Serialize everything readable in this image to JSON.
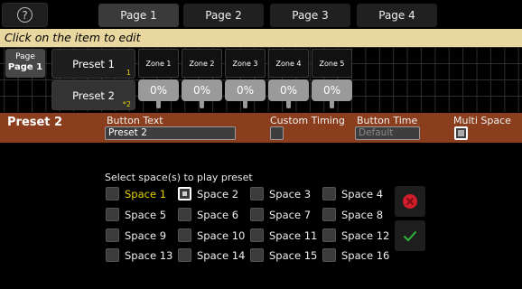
{
  "help": {
    "icon": "question-circle-icon",
    "glyph": "?"
  },
  "tabs": [
    {
      "label": "Page 1",
      "active": true
    },
    {
      "label": "Page 2",
      "active": false
    },
    {
      "label": "Page 3",
      "active": false
    },
    {
      "label": "Page 4",
      "active": false
    }
  ],
  "instruction": "Click on the item to edit",
  "page_button": {
    "line1": "Page",
    "line2": "Page 1"
  },
  "presets": [
    {
      "label": "Preset 1",
      "badge": "1",
      "selected": false
    },
    {
      "label": "Preset 2",
      "badge": "*2",
      "selected": true
    }
  ],
  "zones": [
    {
      "label": "Zone 1",
      "value": "0%"
    },
    {
      "label": "Zone 2",
      "value": "0%"
    },
    {
      "label": "Zone 3",
      "value": "0%"
    },
    {
      "label": "Zone 4",
      "value": "0%"
    },
    {
      "label": "Zone 5",
      "value": "0%"
    }
  ],
  "settings": {
    "title": "Preset 2",
    "button_text_label": "Button Text",
    "button_text_value": "Preset 2",
    "custom_timing_label": "Custom Timing",
    "custom_timing_checked": false,
    "button_time_label": "Button Time",
    "button_time_placeholder": "Default",
    "multi_space_label": "Multi Space",
    "multi_space_checked": true
  },
  "spaces_heading": "Select space(s) to play preset",
  "spaces": [
    {
      "label": "Space 1",
      "checked": false,
      "highlight": true
    },
    {
      "label": "Space 2",
      "checked": true,
      "highlight": false
    },
    {
      "label": "Space 3",
      "checked": false,
      "highlight": false
    },
    {
      "label": "Space 4",
      "checked": false,
      "highlight": false
    },
    {
      "label": "Space 5",
      "checked": false,
      "highlight": false
    },
    {
      "label": "Space 6",
      "checked": false,
      "highlight": false
    },
    {
      "label": "Space 7",
      "checked": false,
      "highlight": false
    },
    {
      "label": "Space 8",
      "checked": false,
      "highlight": false
    },
    {
      "label": "Space 9",
      "checked": false,
      "highlight": false
    },
    {
      "label": "Space 10",
      "checked": false,
      "highlight": false
    },
    {
      "label": "Space 11",
      "checked": false,
      "highlight": false
    },
    {
      "label": "Space 12",
      "checked": false,
      "highlight": false
    },
    {
      "label": "Space 13",
      "checked": false,
      "highlight": false
    },
    {
      "label": "Space 14",
      "checked": false,
      "highlight": false
    },
    {
      "label": "Space 15",
      "checked": false,
      "highlight": false
    },
    {
      "label": "Space 16",
      "checked": false,
      "highlight": false
    }
  ],
  "actions": {
    "cancel_icon": "cancel-icon",
    "confirm_icon": "checkmark-icon"
  },
  "colors": {
    "settings_bar": "#8a3e1d",
    "instruction_bar": "#e8d79f",
    "highlight": "#e6d200",
    "cancel": "#d01f2a",
    "confirm": "#2fb43a"
  }
}
